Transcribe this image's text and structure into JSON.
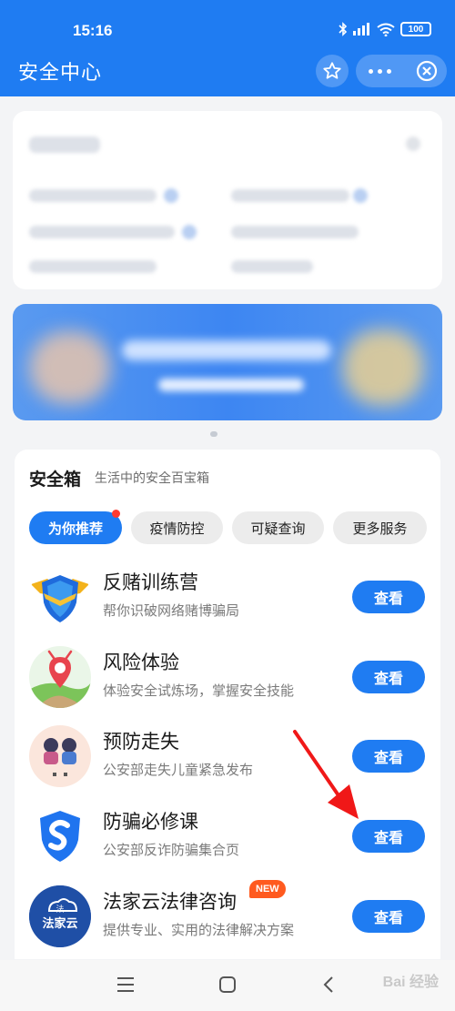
{
  "status_bar": {
    "time": "15:16",
    "battery": "100"
  },
  "header": {
    "title": "安全中心"
  },
  "safety_box": {
    "title": "安全箱",
    "subtitle": "生活中的安全百宝箱",
    "tabs": [
      {
        "label": "为你推荐",
        "active": true
      },
      {
        "label": "疫情防控",
        "active": false
      },
      {
        "label": "可疑查询",
        "active": false
      },
      {
        "label": "更多服务",
        "active": false
      }
    ],
    "items": [
      {
        "name": "反赌训练营",
        "desc": "帮你识破网络赌博骗局",
        "button": "查看",
        "icon": "shield-wings-icon"
      },
      {
        "name": "风险体验",
        "desc": "体验安全试炼场，掌握安全技能",
        "button": "查看",
        "icon": "location-pin-landscape-icon"
      },
      {
        "name": "预防走失",
        "desc": "公安部走失儿童紧急发布",
        "button": "查看",
        "icon": "children-illustration-icon"
      },
      {
        "name": "防骗必修课",
        "desc": "公安部反诈防骗集合页",
        "button": "查看",
        "icon": "shield-s-icon"
      },
      {
        "name": "法家云法律咨询",
        "desc": "提供专业、实用的法律解决方案",
        "button": "查看",
        "badge": "NEW",
        "icon": "fajiayun-logo-icon",
        "logo_text_top": "法",
        "logo_text_bottom": "法家云"
      }
    ]
  },
  "watermark": "Bai 经验",
  "colors": {
    "primary": "#1f7cf2",
    "badge": "#ff5a1f",
    "arrow": "#f01818"
  }
}
